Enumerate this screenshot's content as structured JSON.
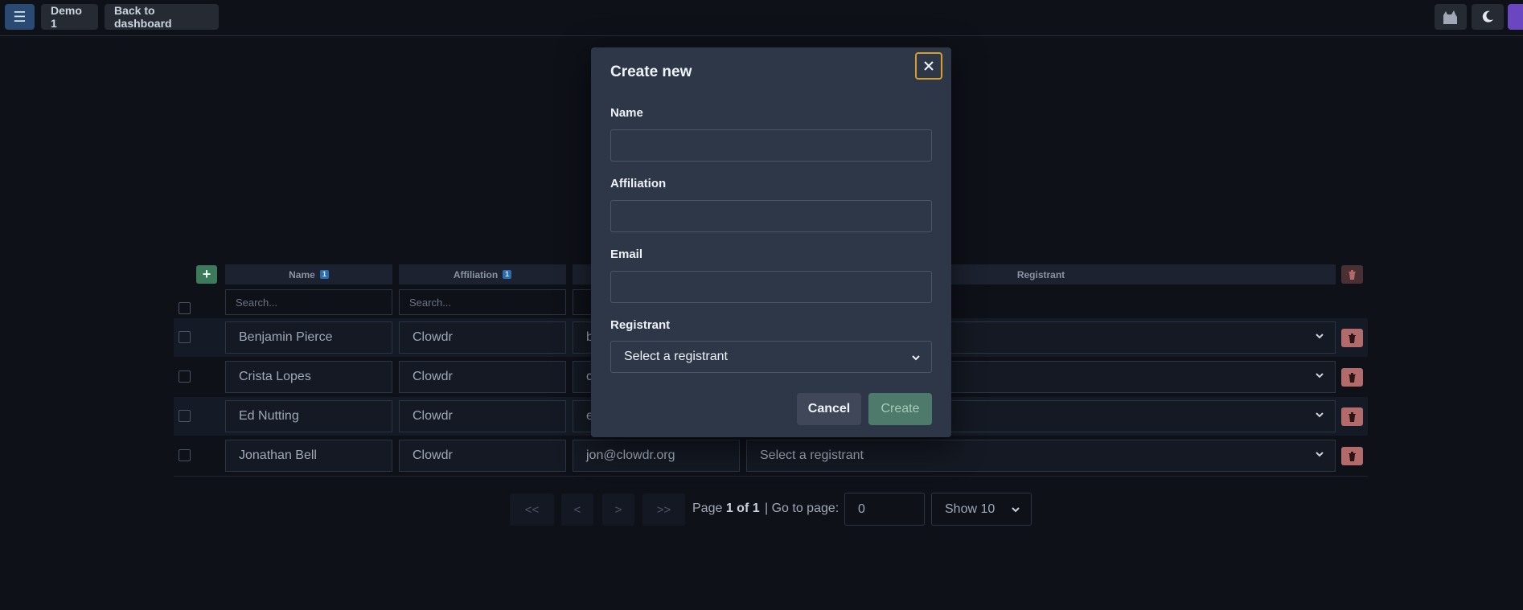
{
  "topbar": {
    "conference_label": "Demo 1",
    "back_label": "Back to dashboard"
  },
  "table": {
    "columns": {
      "name": {
        "label": "Name",
        "sort_badge": "1"
      },
      "affiliation": {
        "label": "Affiliation",
        "sort_badge": "1"
      },
      "registrant": {
        "label": "Registrant"
      }
    },
    "search_placeholder": "Search...",
    "rows": [
      {
        "name": "Benjamin Pierce",
        "affiliation": "Clowdr",
        "email": "b",
        "registrant": ""
      },
      {
        "name": "Crista Lopes",
        "affiliation": "Clowdr",
        "email": "c",
        "registrant": ""
      },
      {
        "name": "Ed Nutting",
        "affiliation": "Clowdr",
        "email": "e",
        "registrant": ""
      },
      {
        "name": "Jonathan Bell",
        "affiliation": "Clowdr",
        "email": "jon@clowdr.org",
        "registrant": "Select a registrant"
      }
    ]
  },
  "pagination": {
    "first": "<<",
    "prev": "<",
    "next": ">",
    "last": ">>",
    "page_prefix": "Page",
    "page_current": "1 of 1",
    "goto_label": "| Go to page:",
    "goto_value": "0",
    "show_label": "Show 10"
  },
  "modal": {
    "title": "Create new",
    "name_label": "Name",
    "affiliation_label": "Affiliation",
    "email_label": "Email",
    "registrant_label": "Registrant",
    "registrant_placeholder": "Select a registrant",
    "cancel_label": "Cancel",
    "create_label": "Create"
  },
  "colors": {
    "background": "#0e1118",
    "modal": "#2d3748",
    "add_button": "#3d7a5c",
    "delete_button": "#b26a6a",
    "focus_ring": "#d69e2e"
  }
}
